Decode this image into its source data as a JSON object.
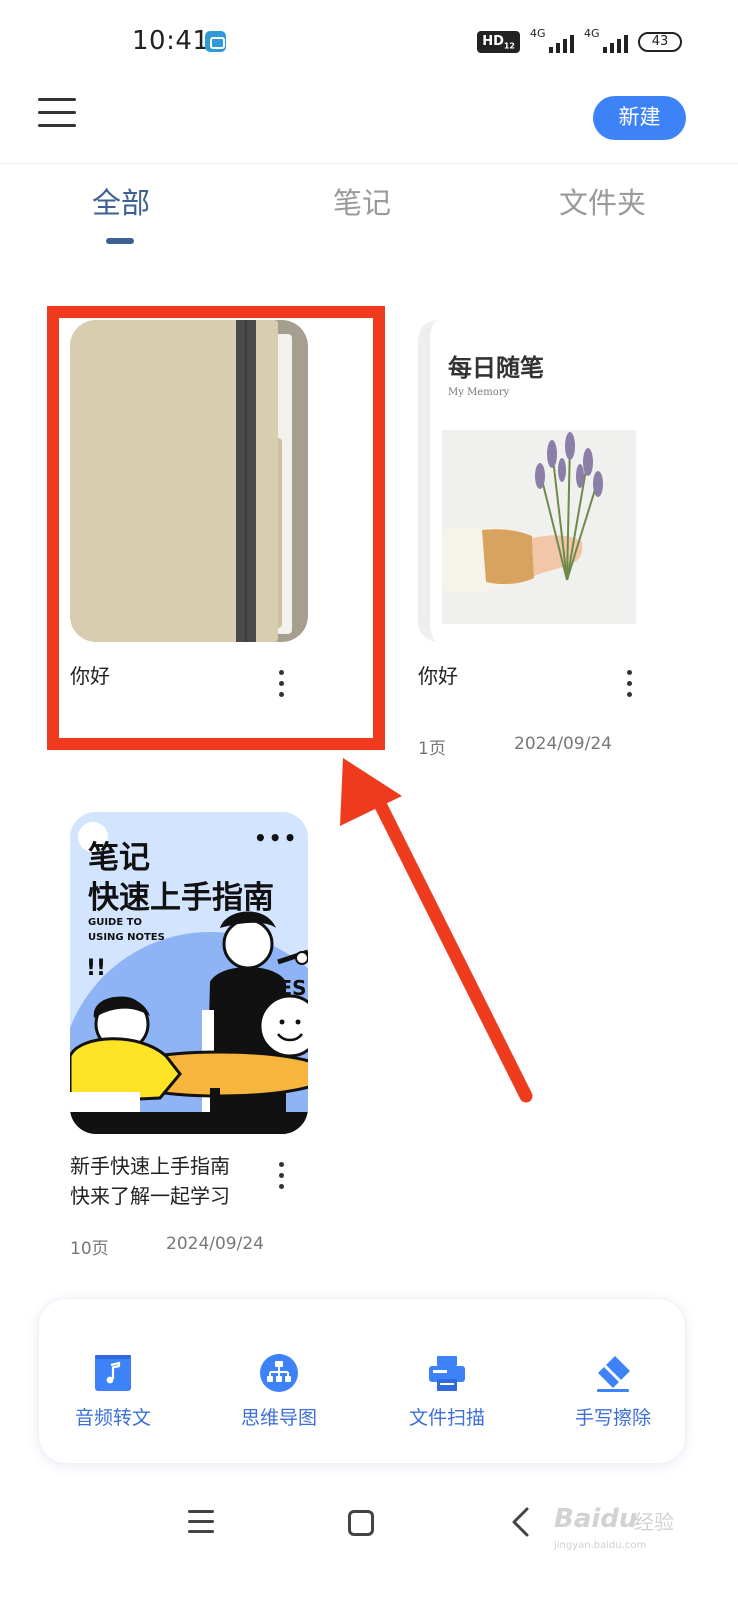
{
  "status_bar": {
    "time": "10:41",
    "hd": "HD",
    "network_1": "4G",
    "network_2": "4G",
    "battery": "43"
  },
  "app_bar": {
    "new_label": "新建"
  },
  "tabs": [
    {
      "label": "全部",
      "active": true
    },
    {
      "label": "笔记",
      "active": false
    },
    {
      "label": "文件夹",
      "active": false
    }
  ],
  "cards": [
    {
      "title": "你好",
      "cover": "notebook-cover",
      "cover_color": "#d8ccb1"
    },
    {
      "title": "你好",
      "pages": "1页",
      "date": "2024/09/24",
      "cover": "memory-cover",
      "cover_title": "每日随笔",
      "cover_subtitle": "My Memory"
    },
    {
      "title_line1": "新手快速上手指南",
      "title_line2": "快来了解一起学习",
      "pages": "10页",
      "date": "2024/09/24",
      "cover": "guide-cover",
      "cover_line1": "笔记",
      "cover_line2": "快速上手指南",
      "cover_en1": "GUIDE TO",
      "cover_en2": "USING NOTES",
      "cover_more": "•••",
      "cover_exclaim": "!!",
      "cover_yes": "YES"
    }
  ],
  "quick_tools": [
    {
      "label": "音频转文",
      "icon": "audio-note-icon"
    },
    {
      "label": "思维导图",
      "icon": "mind-map-icon"
    },
    {
      "label": "文件扫描",
      "icon": "scanner-icon"
    },
    {
      "label": "手写擦除",
      "icon": "eraser-icon"
    }
  ],
  "watermark": {
    "brand": "Bai",
    "brand2": "du",
    "cn": "经验",
    "url": "jingyan.baidu.com"
  },
  "colors": {
    "accent": "#3e82f7",
    "tab_active": "#3f5e92",
    "highlight": "#ee3b1e",
    "tool_label": "#3d6fd8"
  }
}
